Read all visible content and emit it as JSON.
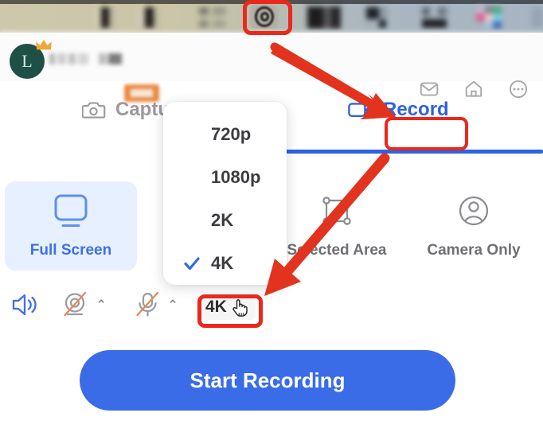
{
  "taskbar": {
    "app_icon_name": "screen-recorder-app-icon",
    "highlighted": true
  },
  "header": {
    "avatar_letter": "L",
    "avatar_color": "#1e5045",
    "icons": [
      {
        "name": "mail-icon",
        "label": "Mail"
      },
      {
        "name": "home-icon",
        "label": "Home"
      },
      {
        "name": "more-icon",
        "label": "More"
      }
    ]
  },
  "tabs": {
    "items": [
      {
        "label": "Captu",
        "full_label": "Capture",
        "icon": "camera-icon",
        "active": false
      },
      {
        "label": "Record",
        "icon": "video-camera-icon",
        "active": true
      }
    ],
    "active_color": "#2e62e0",
    "inactive_color": "#9a9a9e"
  },
  "modes": {
    "items": [
      {
        "label": "Full Screen",
        "icon": "monitor-icon",
        "selected": true
      },
      {
        "label": "Selected Area",
        "icon": "selection-icon",
        "selected": false
      },
      {
        "label": "Camera Only",
        "icon": "person-circle-icon",
        "selected": false
      }
    ],
    "selected_bg": "#e6f0fe",
    "selected_color": "#3d6fe8"
  },
  "controls": {
    "speaker": {
      "name": "speaker-toggle",
      "state": "on",
      "icon": "speaker-icon"
    },
    "webcam": {
      "name": "webcam-toggle",
      "state": "off",
      "icon": "webcam-off-icon",
      "chevron": "⌃"
    },
    "microphone": {
      "name": "microphone-toggle",
      "state": "off",
      "icon": "microphone-off-icon",
      "chevron": "⌃"
    },
    "resolution_button": {
      "label": "4K",
      "cursor": "pointer-hand-cursor"
    }
  },
  "dropdown": {
    "open": true,
    "options": [
      {
        "label": "720p",
        "checked": false
      },
      {
        "label": "1080p",
        "checked": false
      },
      {
        "label": "2K",
        "checked": false
      },
      {
        "label": "4K",
        "checked": true
      }
    ],
    "check_color": "#2f6ce6"
  },
  "primary_action": {
    "label": "Start Recording",
    "color": "#3b6ce8"
  },
  "annotations": {
    "highlight_color": "#e8291c",
    "boxes": [
      {
        "name": "highlight-app-icon",
        "target": "screen-recorder-app-icon"
      },
      {
        "name": "highlight-record-tab",
        "target": "Record"
      },
      {
        "name": "highlight-resolution-button",
        "target": "4K"
      }
    ],
    "arrows": [
      {
        "name": "arrow-to-record-tab",
        "from": "taskbar app icon",
        "to": "Record tab"
      },
      {
        "name": "arrow-to-resolution-button",
        "from": "Record tab",
        "to": "4K button"
      }
    ]
  }
}
